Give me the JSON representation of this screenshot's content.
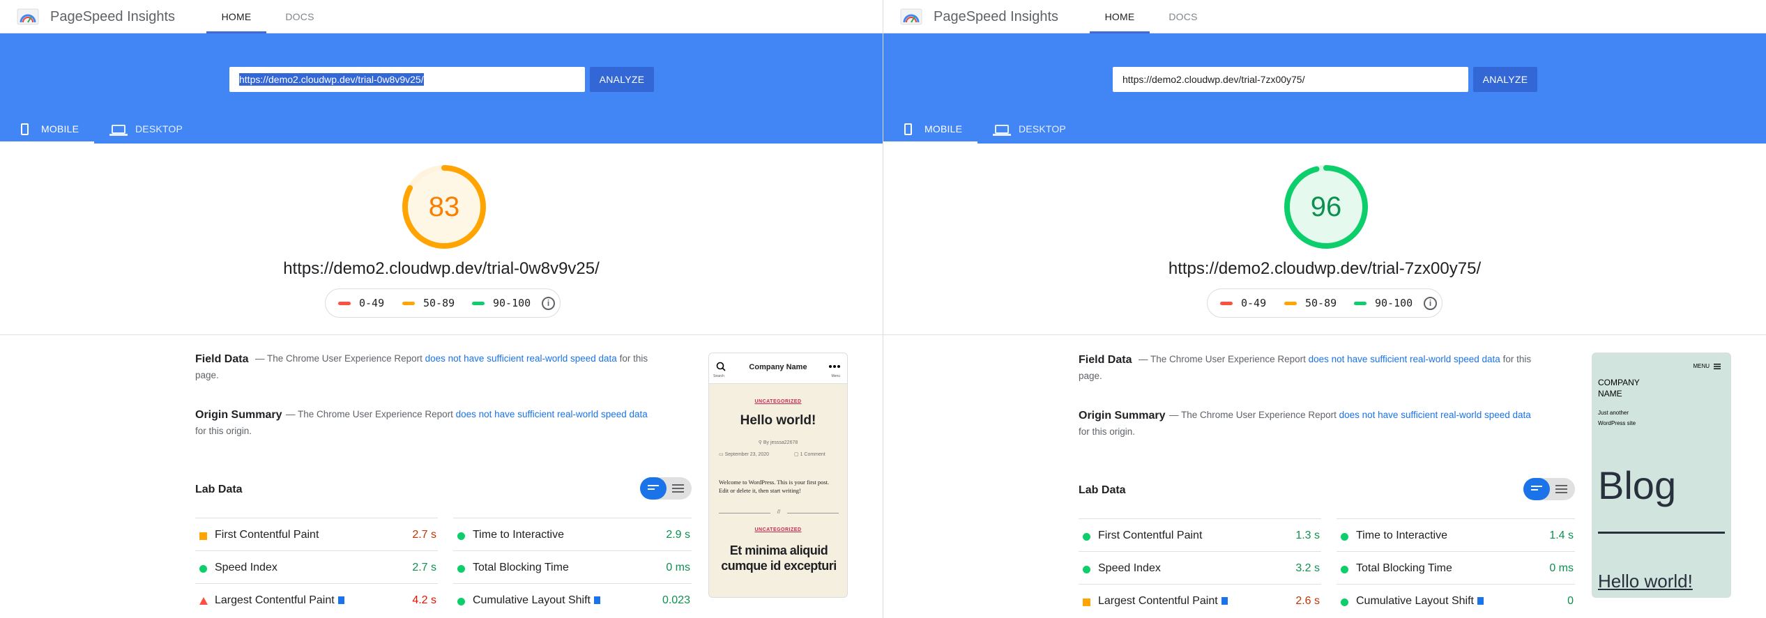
{
  "panels": [
    {
      "app": {
        "title": "PageSpeed Insights",
        "nav": [
          "HOME",
          "DOCS"
        ]
      },
      "search": {
        "url": "https://demo2.cloudwp.dev/trial-0w8v9v25/",
        "url_selected": true,
        "analyze": "ANALYZE"
      },
      "device_tabs": {
        "mobile": "MOBILE",
        "desktop": "DESKTOP",
        "active": "mobile"
      },
      "score": {
        "value": "83",
        "fraction": 0.83,
        "rating": "average",
        "color": "#ffa400",
        "text_color": "#fa7e00"
      },
      "page_url": "https://demo2.cloudwp.dev/trial-0w8v9v25/",
      "legend": [
        {
          "range": "0-49",
          "color": "#ff4e42"
        },
        {
          "range": "50-89",
          "color": "#ffa400"
        },
        {
          "range": "90-100",
          "color": "#0cce6b"
        }
      ],
      "field_data": {
        "title": "Field Data",
        "dash": "—",
        "pre": "The Chrome User Experience Report",
        "link": "does not have sufficient real-world speed data",
        "post": "for this page."
      },
      "origin_summary": {
        "title": "Origin Summary",
        "dash": "—",
        "pre": "The Chrome User Experience Report",
        "link": "does not have sufficient real-world speed data",
        "post": "for this origin."
      },
      "lab_data": {
        "title": "Lab Data",
        "metrics": [
          {
            "label": "First Contentful Paint",
            "value": "2.7 s",
            "status": "orange",
            "flag": false
          },
          {
            "label": "Time to Interactive",
            "value": "2.9 s",
            "status": "green",
            "flag": false
          },
          {
            "label": "Speed Index",
            "value": "2.7 s",
            "status": "green",
            "flag": false
          },
          {
            "label": "Total Blocking Time",
            "value": "0 ms",
            "status": "green",
            "flag": false
          },
          {
            "label": "Largest Contentful Paint",
            "value": "4.2 s",
            "status": "red",
            "flag": true
          },
          {
            "label": "Cumulative Layout Shift",
            "value": "0.023",
            "status": "green",
            "flag": true
          }
        ]
      },
      "preview": {
        "company": "Company Name",
        "search_label": "Search",
        "menu_label": "Menu",
        "category": "UNCATEGORIZED",
        "post_title": "Hello world!",
        "author": "By jesssa22678",
        "date": "September 23, 2020",
        "comments": "1 Comment",
        "body": "Welcome to WordPress. This is your first post. Edit or delete it, then start writing!",
        "separator": "//",
        "category2": "UNCATEGORIZED",
        "post2_title": "Et minima aliquid cumque id excepturi"
      }
    },
    {
      "app": {
        "title": "PageSpeed Insights",
        "nav": [
          "HOME",
          "DOCS"
        ]
      },
      "search": {
        "url": "https://demo2.cloudwp.dev/trial-7zx00y75/",
        "url_selected": false,
        "analyze": "ANALYZE"
      },
      "device_tabs": {
        "mobile": "MOBILE",
        "desktop": "DESKTOP",
        "active": "mobile"
      },
      "score": {
        "value": "96",
        "fraction": 0.96,
        "rating": "good",
        "color": "#0cce6b",
        "text_color": "#0d904f"
      },
      "page_url": "https://demo2.cloudwp.dev/trial-7zx00y75/",
      "legend": [
        {
          "range": "0-49",
          "color": "#ff4e42"
        },
        {
          "range": "50-89",
          "color": "#ffa400"
        },
        {
          "range": "90-100",
          "color": "#0cce6b"
        }
      ],
      "field_data": {
        "title": "Field Data",
        "dash": "—",
        "pre": "The Chrome User Experience Report",
        "link": "does not have sufficient real-world speed data",
        "post": "for this page."
      },
      "origin_summary": {
        "title": "Origin Summary",
        "dash": "—",
        "pre": "The Chrome User Experience Report",
        "link": "does not have sufficient real-world speed data",
        "post": "for this origin."
      },
      "lab_data": {
        "title": "Lab Data",
        "metrics": [
          {
            "label": "First Contentful Paint",
            "value": "1.3 s",
            "status": "green",
            "flag": false
          },
          {
            "label": "Time to Interactive",
            "value": "1.4 s",
            "status": "green",
            "flag": false
          },
          {
            "label": "Speed Index",
            "value": "3.2 s",
            "status": "green",
            "flag": false
          },
          {
            "label": "Total Blocking Time",
            "value": "0 ms",
            "status": "green",
            "flag": false
          },
          {
            "label": "Largest Contentful Paint",
            "value": "2.6 s",
            "status": "orange",
            "flag": true
          },
          {
            "label": "Cumulative Layout Shift",
            "value": "0",
            "status": "green",
            "flag": true
          }
        ]
      },
      "preview": {
        "menu_label": "MENU",
        "company_line1": "COMPANY",
        "company_line2": "NAME",
        "tagline_line1": "Just another",
        "tagline_line2": "WordPress site",
        "heading": "Blog",
        "post_title": "Hello world!"
      }
    }
  ]
}
